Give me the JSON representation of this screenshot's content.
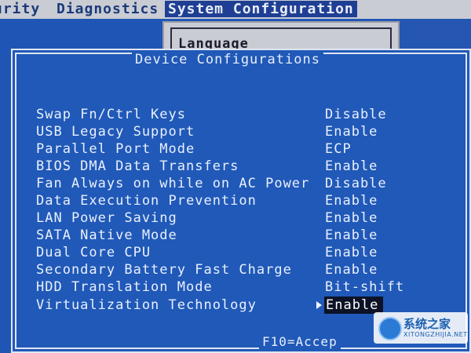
{
  "menubar": {
    "items": [
      "urity",
      "Diagnostics",
      "System Configuration"
    ],
    "active_index": 2
  },
  "background_panel": {
    "label": "Language"
  },
  "dialog": {
    "title": "Device Configurations",
    "rows": [
      {
        "label": "Swap Fn/Ctrl Keys",
        "value": "Disable"
      },
      {
        "label": "USB Legacy Support",
        "value": "Enable"
      },
      {
        "label": "Parallel Port Mode",
        "value": "ECP"
      },
      {
        "label": "BIOS DMA Data Transfers",
        "value": "Enable"
      },
      {
        "label": "Fan Always on while on AC Power",
        "value": "Disable"
      },
      {
        "label": "Data Execution Prevention",
        "value": "Enable"
      },
      {
        "label": "LAN Power Saving",
        "value": "Enable"
      },
      {
        "label": "SATA Native Mode",
        "value": "Enable"
      },
      {
        "label": "Dual Core CPU",
        "value": "Enable"
      },
      {
        "label": "Secondary Battery Fast Charge",
        "value": "Enable"
      },
      {
        "label": "HDD Translation Mode",
        "value": "Bit-shift"
      },
      {
        "label": "Virtualization Technology",
        "value": "Enable"
      }
    ],
    "selected_index": 11,
    "footer_hint": "F10=Accep"
  },
  "watermark": {
    "text": "系统之家",
    "subtext": "XITONGZHIJIA.NET"
  },
  "colors": {
    "background": "#1f56b6",
    "menubar": "#c9ccd3",
    "selection": "#0c1326",
    "text": "#eaf0fd"
  }
}
